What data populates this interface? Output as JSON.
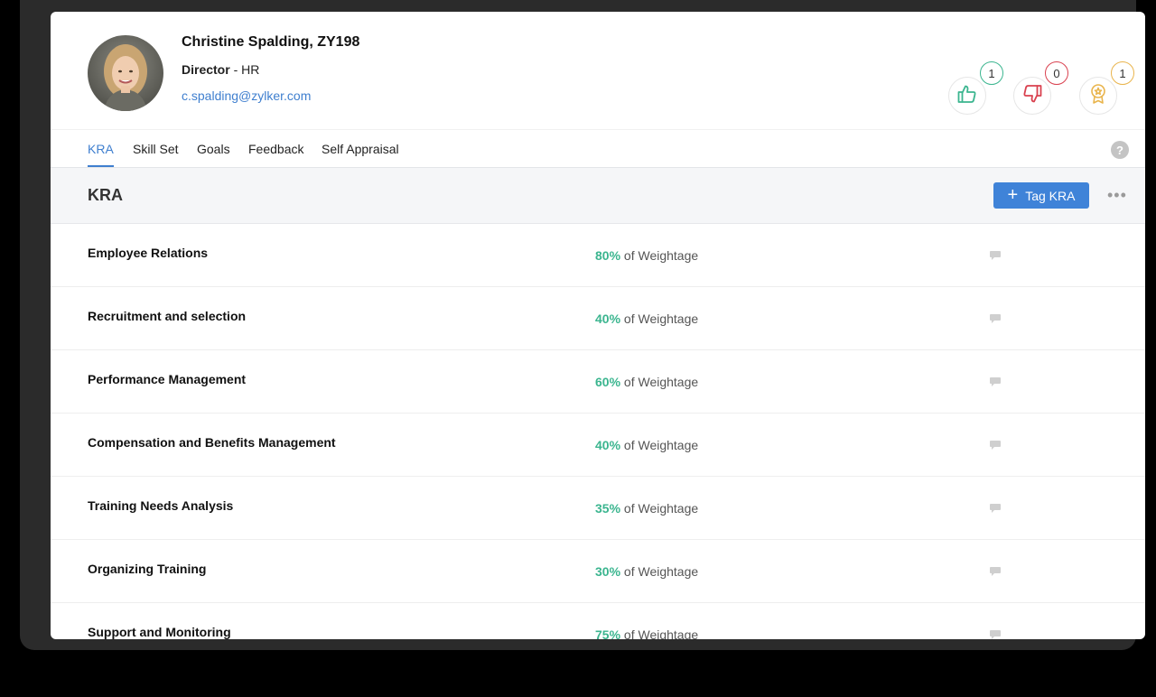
{
  "profile": {
    "name": "Christine Spalding, ZY198",
    "designation": "Director",
    "separator": " - ",
    "department": "HR",
    "email": "c.spalding@zylker.com"
  },
  "badges": {
    "likes": "1",
    "dislikes": "0",
    "awards": "1"
  },
  "tabs": [
    {
      "label": "KRA",
      "active": true
    },
    {
      "label": "Skill Set"
    },
    {
      "label": "Goals"
    },
    {
      "label": "Feedback"
    },
    {
      "label": "Self Appraisal"
    }
  ],
  "help_label": "?",
  "section": {
    "title": "KRA",
    "tag_button": "Tag KRA",
    "more_label": "•••"
  },
  "weightage_suffix": " of Weightage",
  "kra_rows": [
    {
      "title": "Employee Relations",
      "weight": "80%"
    },
    {
      "title": "Recruitment and selection",
      "weight": "40%"
    },
    {
      "title": "Performance Management",
      "weight": "60%"
    },
    {
      "title": "Compensation and Benefits Management",
      "weight": "40%"
    },
    {
      "title": "Training Needs Analysis",
      "weight": "35%"
    },
    {
      "title": "Organizing Training",
      "weight": "30%"
    },
    {
      "title": "Support and Monitoring",
      "weight": "75%"
    }
  ],
  "colors": {
    "accent": "#3f7fcf",
    "button": "#3f83d8",
    "weight_green": "#3bb58f",
    "like": "#3bb58f",
    "dislike": "#d9414f",
    "award": "#e9b44c"
  }
}
